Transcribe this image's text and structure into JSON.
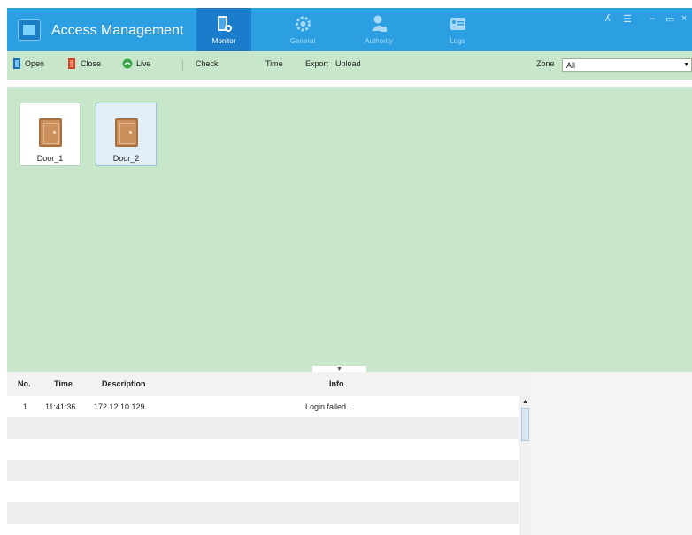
{
  "app": {
    "title": "Access Management"
  },
  "nav": {
    "tabs": [
      {
        "label": "Monitor",
        "icon": "door-monitor-icon",
        "active": true
      },
      {
        "label": "General",
        "icon": "gear-icon",
        "active": false
      },
      {
        "label": "Authority",
        "icon": "user-lock-icon",
        "active": false
      },
      {
        "label": "Logs",
        "icon": "log-card-icon",
        "active": false
      }
    ]
  },
  "window_controls": {
    "user": "ʎ",
    "menu": "☰",
    "minimize": "–",
    "maximize": "▭",
    "close": "×"
  },
  "toolbar": {
    "open": "Open",
    "close": "Close",
    "live": "Live",
    "check": "Check",
    "time": "Time",
    "export": "Export",
    "upload": "Upload",
    "zone_label": "Zone",
    "zone_value": "All"
  },
  "doors": [
    {
      "label": "Door_1",
      "selected": false
    },
    {
      "label": "Door_2",
      "selected": true
    }
  ],
  "log": {
    "headers": {
      "no": "No.",
      "time": "Time",
      "description": "Description",
      "info": "Info"
    },
    "rows": [
      {
        "no": "1",
        "time": "11:41:36",
        "description": "172.12.10.129",
        "info": "Login failed."
      }
    ]
  },
  "colors": {
    "titlebar": "#2b9fe2",
    "active_tab": "#1c7ccc",
    "panel_green": "#c8e6c9"
  }
}
